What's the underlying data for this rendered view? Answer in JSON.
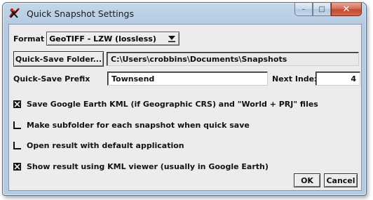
{
  "window": {
    "title": "Quick Snapshot Settings",
    "controls": {
      "minimize": "–",
      "maximize": "□",
      "close": "✕"
    }
  },
  "format": {
    "label": "Format",
    "selected": "GeoTIFF - LZW (lossless)"
  },
  "quick_save_folder": {
    "button_label": "Quick-Save Folder...",
    "value": "C:\\Users\\crobbins\\Documents\\Snapshots"
  },
  "quick_save_prefix": {
    "label": "Quick-Save Prefix",
    "value": "Townsend"
  },
  "next_index": {
    "label": "Next Index",
    "value": "4"
  },
  "options": [
    {
      "label": "Save Google Earth KML (if Geographic CRS) and \"World + PRJ\" files",
      "checked": true
    },
    {
      "label": "Make subfolder for each snapshot when quick save",
      "checked": false
    },
    {
      "label": "Open result with default application",
      "checked": false
    },
    {
      "label": "Show result using KML viewer (usually in Google Earth)",
      "checked": true
    }
  ],
  "buttons": {
    "ok": "OK",
    "cancel": "Cancel"
  }
}
